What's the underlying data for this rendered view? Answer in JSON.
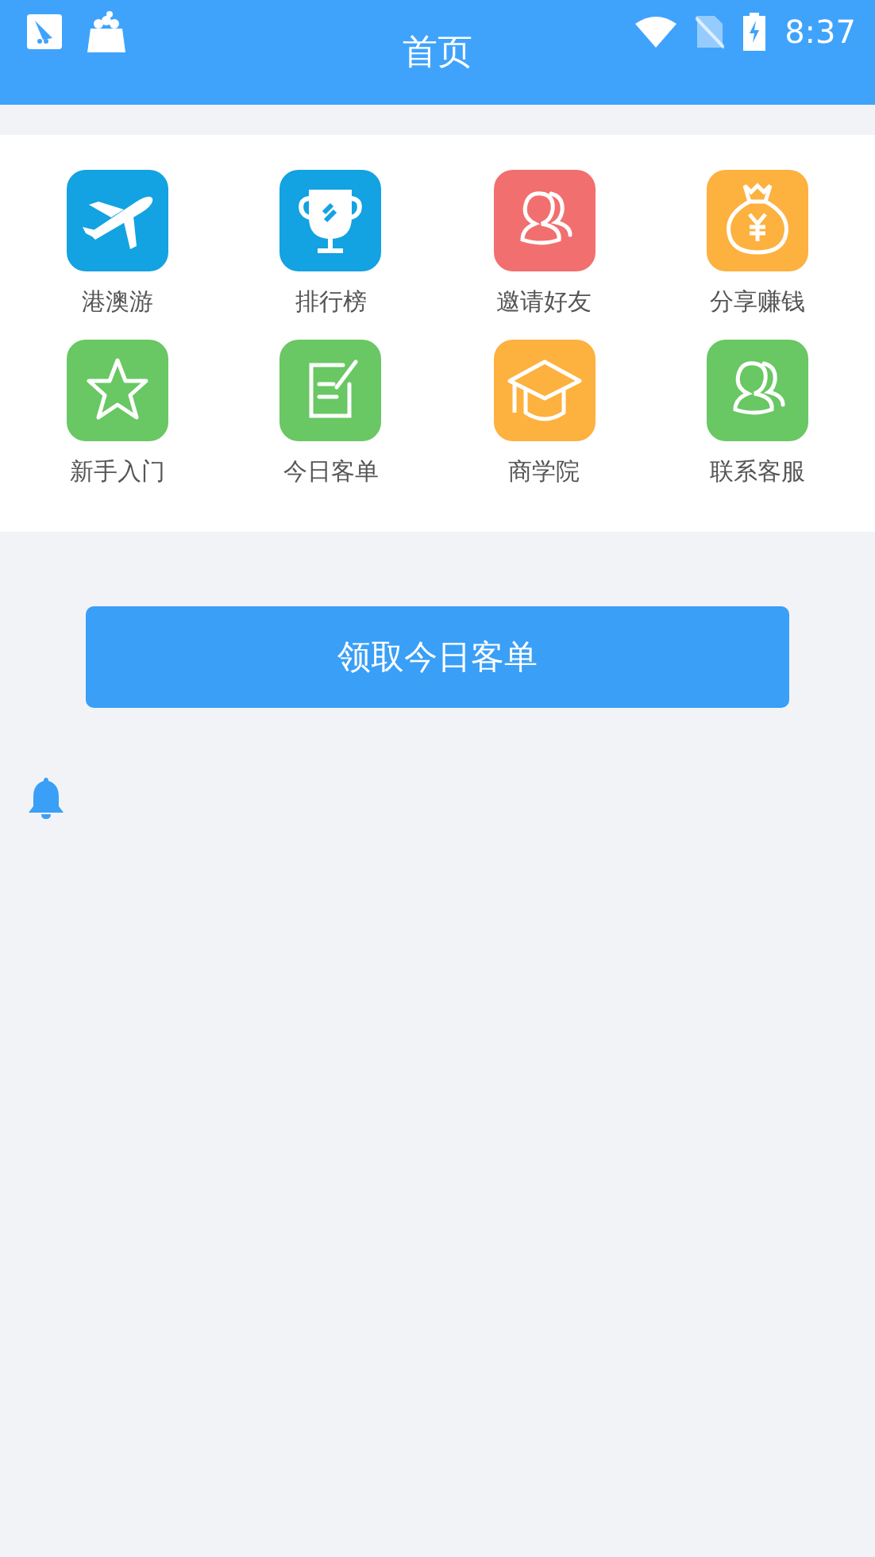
{
  "status_bar": {
    "time": "8:37"
  },
  "header": {
    "title": "首页"
  },
  "menu": [
    {
      "label": "港澳游",
      "kind": "plane",
      "color": "#13a2e2"
    },
    {
      "label": "排行榜",
      "kind": "trophy",
      "color": "#13a2e2"
    },
    {
      "label": "邀请好友",
      "kind": "people",
      "color": "#f26f6f"
    },
    {
      "label": "分享赚钱",
      "kind": "moneybag",
      "color": "#fdb13f"
    },
    {
      "label": "新手入门",
      "kind": "star",
      "color": "#69c764"
    },
    {
      "label": "今日客单",
      "kind": "note",
      "color": "#69c764"
    },
    {
      "label": "商学院",
      "kind": "cap",
      "color": "#fdb13f"
    },
    {
      "label": "联系客服",
      "kind": "people",
      "color": "#69c764"
    }
  ],
  "action_button": {
    "label": "领取今日客单"
  }
}
